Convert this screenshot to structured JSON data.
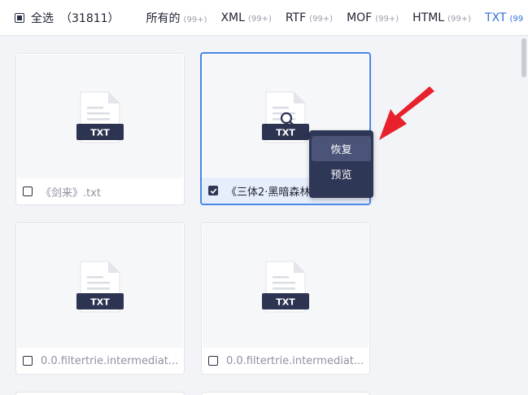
{
  "toolbar": {
    "select_all_label": "全选",
    "select_all_count": "（31811）",
    "tabs": [
      {
        "name": "所有的",
        "badge": "(99+)"
      },
      {
        "name": "XML",
        "badge": "(99+)"
      },
      {
        "name": "RTF",
        "badge": "(99+)"
      },
      {
        "name": "MOF",
        "badge": "(99+)"
      },
      {
        "name": "HTML",
        "badge": "(99+)"
      },
      {
        "name": "TXT",
        "badge": "(99"
      }
    ],
    "active_tab": "TXT"
  },
  "files": [
    {
      "name": "《剑来》.txt",
      "type_label": "TXT",
      "checked": false
    },
    {
      "name": "《三体2·黑暗森林",
      "type_label": "TXT",
      "checked": true
    },
    {
      "name": "0.0.filtertrie.intermediat...",
      "type_label": "TXT",
      "checked": false
    },
    {
      "name": "0.0.filtertrie.intermediat...",
      "type_label": "TXT",
      "checked": false
    }
  ],
  "context_menu": {
    "items": [
      "恢复",
      "预览"
    ]
  },
  "colors": {
    "accent": "#2f6fdc",
    "selection_border": "#4a86e8",
    "menu_bg": "#2f3756",
    "arrow": "#e8212c"
  }
}
